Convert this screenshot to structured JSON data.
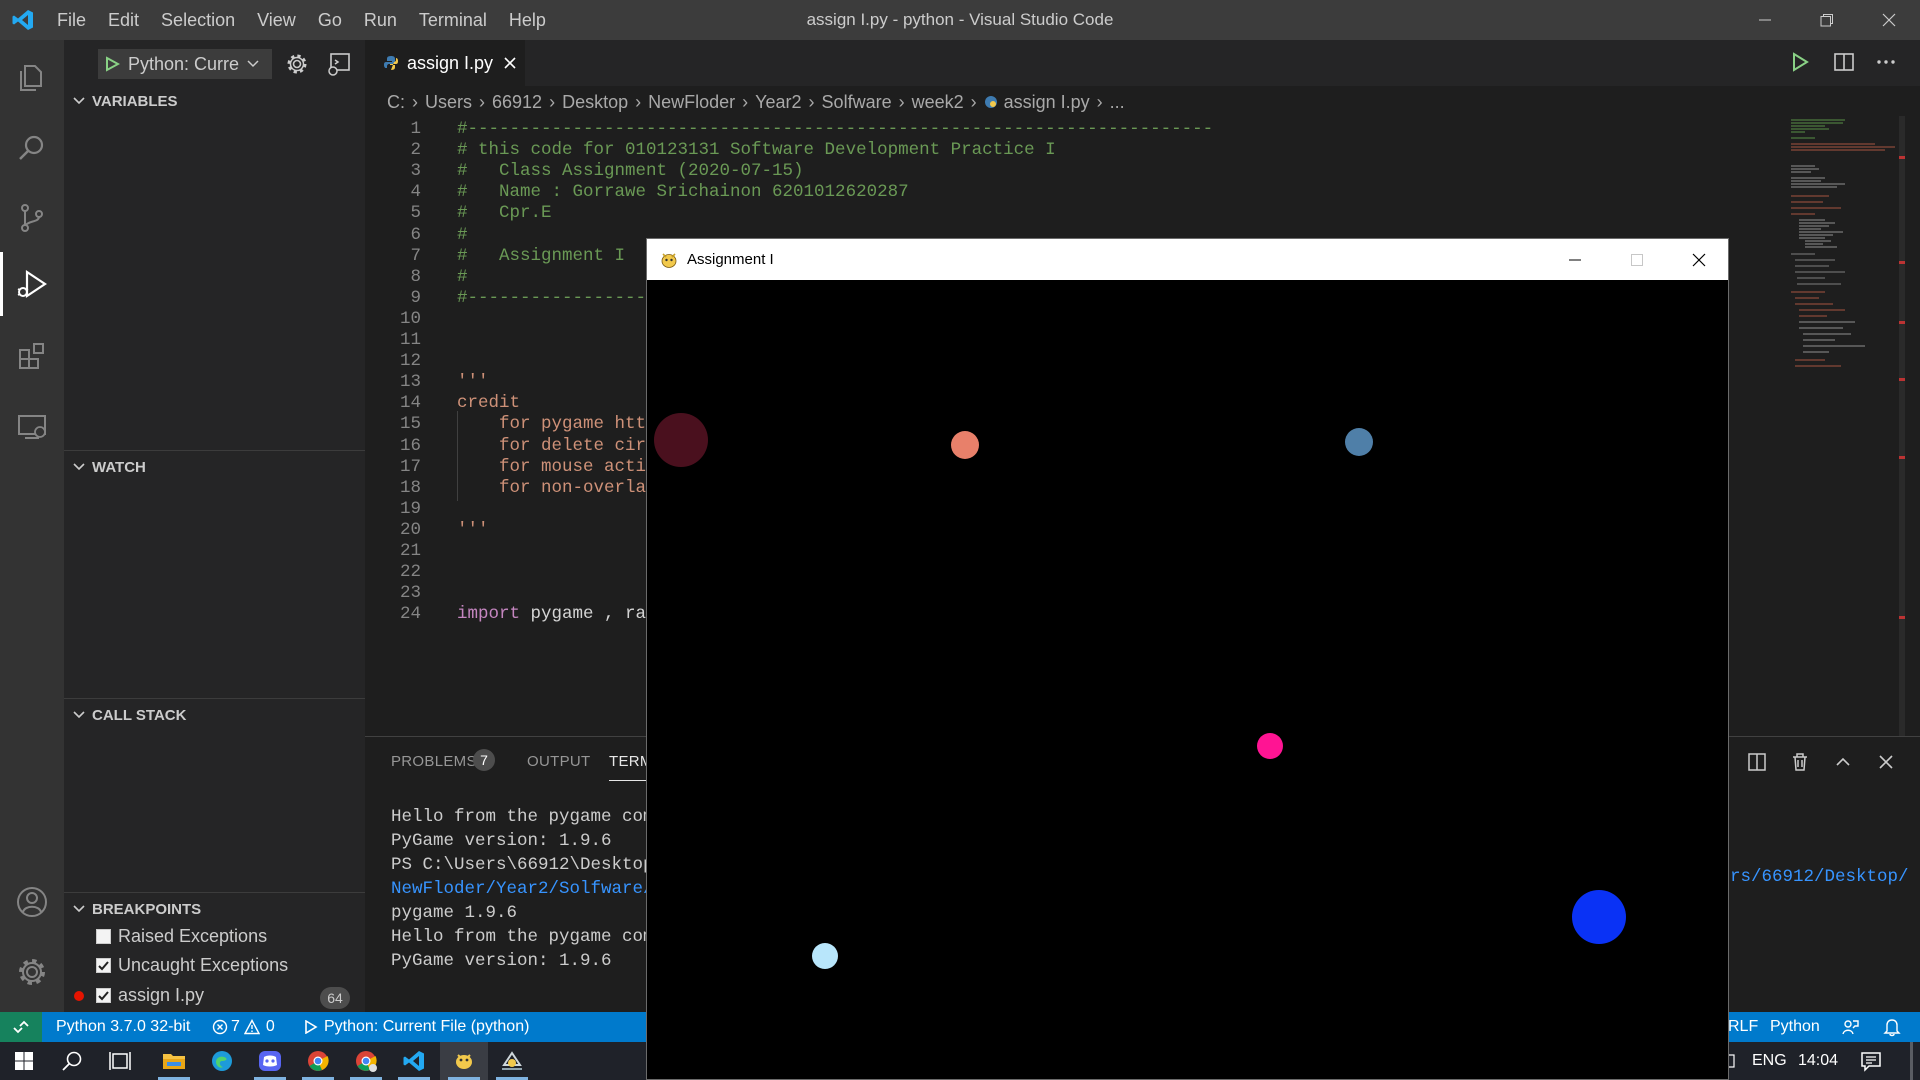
{
  "titlebar": {
    "menu": [
      "File",
      "Edit",
      "Selection",
      "View",
      "Go",
      "Run",
      "Terminal",
      "Help"
    ],
    "window_title": "assign I.py - python - Visual Studio Code"
  },
  "activitybar": {
    "icons": [
      "explorer-icon",
      "search-icon",
      "source-control-icon",
      "run-debug-icon",
      "extensions-icon",
      "remote-explorer-icon",
      "account-icon",
      "manage-gear-icon"
    ]
  },
  "sidebar": {
    "run_config": "Python: Curre",
    "sections": {
      "variables": "VARIABLES",
      "watch": "WATCH",
      "call_stack": "CALL STACK",
      "breakpoints": "BREAKPOINTS"
    },
    "breakpoints": [
      {
        "label": "Raised Exceptions",
        "checked": false
      },
      {
        "label": "Uncaught Exceptions",
        "checked": true
      },
      {
        "label": "assign I.py",
        "checked": true,
        "line": "64"
      }
    ]
  },
  "editor": {
    "tab": "assign I.py",
    "breadcrumb": [
      "C:",
      "Users",
      "66912",
      "Desktop",
      "NewFloder",
      "Year2",
      "Solfware",
      "week2",
      "assign I.py",
      "..."
    ],
    "lines": [
      {
        "n": "1",
        "text": "#-----------------------------------------------------------------------",
        "cls": "cmt",
        "indent": false
      },
      {
        "n": "2",
        "text": "# this code for 010123131 Software Development Practice I",
        "cls": "cmt",
        "indent": false
      },
      {
        "n": "3",
        "text": "#   Class Assignment (2020-07-15)",
        "cls": "cmt",
        "indent": false
      },
      {
        "n": "4",
        "text": "#   Name : Gorrawe Srichainon 6201012620287",
        "cls": "cmt",
        "indent": false
      },
      {
        "n": "5",
        "text": "#   Cpr.E",
        "cls": "cmt",
        "indent": false
      },
      {
        "n": "6",
        "text": "#",
        "cls": "cmt",
        "indent": false
      },
      {
        "n": "7",
        "text": "#   Assignment I",
        "cls": "cmt",
        "indent": false
      },
      {
        "n": "8",
        "text": "#",
        "cls": "cmt",
        "indent": false
      },
      {
        "n": "9",
        "text": "#-----------------",
        "cls": "cmt",
        "indent": false
      },
      {
        "n": "10",
        "text": "",
        "cls": "plain",
        "indent": false
      },
      {
        "n": "11",
        "text": "",
        "cls": "plain",
        "indent": false
      },
      {
        "n": "12",
        "text": "",
        "cls": "plain",
        "indent": false
      },
      {
        "n": "13",
        "text": "'''",
        "cls": "str",
        "indent": false
      },
      {
        "n": "14",
        "text": "credit",
        "cls": "str",
        "indent": false
      },
      {
        "n": "15",
        "text": "    for pygame htt",
        "cls": "str",
        "indent": true
      },
      {
        "n": "16",
        "text": "    for delete cir",
        "cls": "str",
        "indent": true
      },
      {
        "n": "17",
        "text": "    for mouse acti",
        "cls": "str",
        "indent": true
      },
      {
        "n": "18",
        "text": "    for non-overla",
        "cls": "str",
        "indent": true
      },
      {
        "n": "19",
        "text": "",
        "cls": "str",
        "indent": false
      },
      {
        "n": "20",
        "text": "'''",
        "cls": "str",
        "indent": false
      },
      {
        "n": "21",
        "text": "",
        "cls": "plain",
        "indent": false
      },
      {
        "n": "22",
        "text": "",
        "cls": "plain",
        "indent": false
      },
      {
        "n": "23",
        "text": "",
        "cls": "plain",
        "indent": false
      },
      {
        "n": "24",
        "text": "import pygame , ra",
        "cls": "import",
        "indent": false
      }
    ]
  },
  "panel": {
    "tabs": [
      "PROBLEMS",
      "OUTPUT",
      "TERM"
    ],
    "problems_count": "7",
    "terminal_lines": [
      "Hello from the pygame comm",
      "PyGame version: 1.9.6",
      "PS C:\\Users\\66912\\Desktop\\",
      "NewFloder/Year2/Solfware/w",
      "pygame 1.9.6",
      "Hello from the pygame comm",
      "PyGame version: 1.9.6"
    ],
    "terminal_right_fragment": "rs/66912/Desktop/"
  },
  "statusbar": {
    "interpreter": "Python 3.7.0 32-bit",
    "errors": "7",
    "warnings": "0",
    "debug_config": "Python: Current File (python)",
    "eol": "RLF",
    "language": "Python"
  },
  "taskbar": {
    "language": "ENG",
    "time": "14:04"
  },
  "pygame_window": {
    "title": "Assignment I",
    "circles": [
      {
        "color": "#4a101e"
      },
      {
        "color": "#e8806a"
      },
      {
        "color": "#4f7fa8"
      },
      {
        "color": "#ff1493"
      },
      {
        "color": "#0a32f5"
      },
      {
        "color": "#b8e6fb"
      }
    ]
  },
  "colors": {
    "accent": "#007acc",
    "comment": "#6a9955",
    "string": "#ce9178",
    "keyword": "#c586c0"
  }
}
